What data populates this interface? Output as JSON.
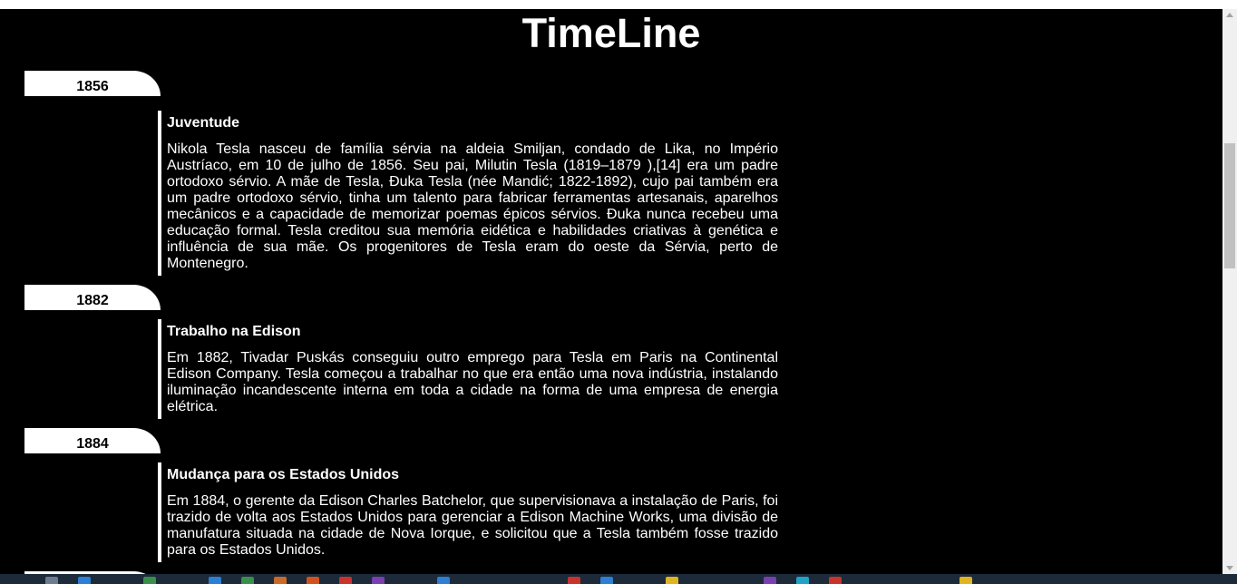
{
  "page": {
    "title": "TimeLine"
  },
  "timeline": [
    {
      "year": "1856",
      "heading": "Juventude",
      "text": "Nikola Tesla nasceu de família sérvia na aldeia Smiljan, condado de Lika, no Império Austríaco, em 10 de julho de 1856. Seu pai, Milutin Tesla (1819–1879 ),[14] era um padre ortodoxo sérvio. A mãe de Tesla, Đuka Tesla (née Mandić; 1822-1892), cujo pai também era um padre ortodoxo sérvio, tinha um talento para fabricar ferramentas artesanais, aparelhos mecânicos e a capacidade de memorizar poemas épicos sérvios. Đuka nunca recebeu uma educação formal. Tesla creditou sua memória eidética e habilidades criativas à genética e influência de sua mãe. Os progenitores de Tesla eram do oeste da Sérvia, perto de Montenegro."
    },
    {
      "year": "1882",
      "heading": "Trabalho na Edison",
      "text": "Em 1882, Tivadar Puskás conseguiu outro emprego para Tesla em Paris na Continental Edison Company. Tesla começou a trabalhar no que era então uma nova indústria, instalando iluminação incandescente interna em toda a cidade na forma de uma empresa de energia elétrica."
    },
    {
      "year": "1884",
      "heading": "Mudança para os Estados Unidos",
      "text": "Em 1884, o gerente da Edison Charles Batchelor, que supervisionava a instalação de Paris, foi trazido de volta aos Estados Unidos para gerenciar a Edison Machine Works, uma divisão de manufatura situada na cidade de Nova Iorque, e solicitou que a Tesla também fosse trazido para os Estados Unidos."
    }
  ],
  "colors": {
    "background": "#000000",
    "text": "#ffffff",
    "tab": "#ffffff",
    "tab_text": "#000000"
  }
}
